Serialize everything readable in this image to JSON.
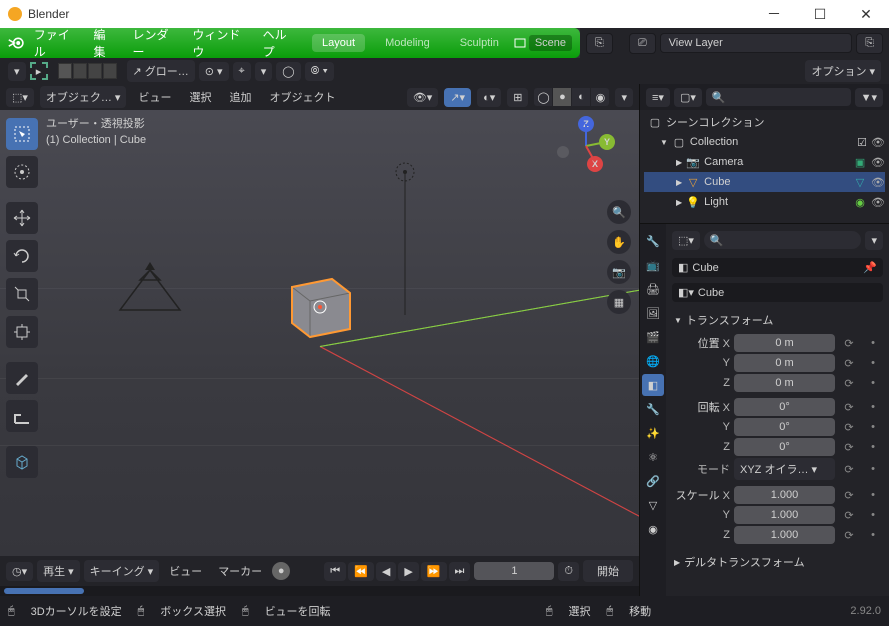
{
  "title": "Blender",
  "menus": [
    "ファイル",
    "編集",
    "レンダー",
    "ウィンドウ",
    "ヘルプ"
  ],
  "workspace_tabs": [
    "Layout",
    "Modeling",
    "Sculptin"
  ],
  "active_tab": "Layout",
  "scene_name": "Scene",
  "view_layer": "View Layer",
  "options_label": "オプション",
  "vp_header": {
    "mode": "オブジェク…",
    "view": "ビュー",
    "select": "選択",
    "add": "追加",
    "object": "オブジェクト",
    "global": "グロー…"
  },
  "vp_info": {
    "line1": "ユーザー・透視投影",
    "line2": "(1) Collection | Cube"
  },
  "outliner": {
    "root": "シーンコレクション",
    "collection": "Collection",
    "items": [
      {
        "name": "Camera",
        "icon": "camera"
      },
      {
        "name": "Cube",
        "icon": "mesh",
        "selected": true
      },
      {
        "name": "Light",
        "icon": "light"
      }
    ]
  },
  "props": {
    "object": "Cube",
    "name_field": "Cube",
    "transform_label": "トランスフォーム",
    "loc_label": "位置",
    "rot_label": "回転",
    "scale_label": "スケール",
    "mode_label": "モード",
    "mode_value": "XYZ オイラ…",
    "loc": {
      "X": "0 m",
      "Y": "0 m",
      "Z": "0 m"
    },
    "rot": {
      "X": "0°",
      "Y": "0°",
      "Z": "0°"
    },
    "scale": {
      "X": "1.000",
      "Y": "1.000",
      "Z": "1.000"
    },
    "delta_label": "デルタトランスフォーム"
  },
  "timeline": {
    "play": "再生",
    "keying": "キーイング",
    "view": "ビュー",
    "marker": "マーカー",
    "frame": "1",
    "start": "開始"
  },
  "status": {
    "cursor": "3Dカーソルを設定",
    "box": "ボックス選択",
    "rotate": "ビューを回転",
    "sel": "選択",
    "move": "移動",
    "version": "2.92.0"
  }
}
